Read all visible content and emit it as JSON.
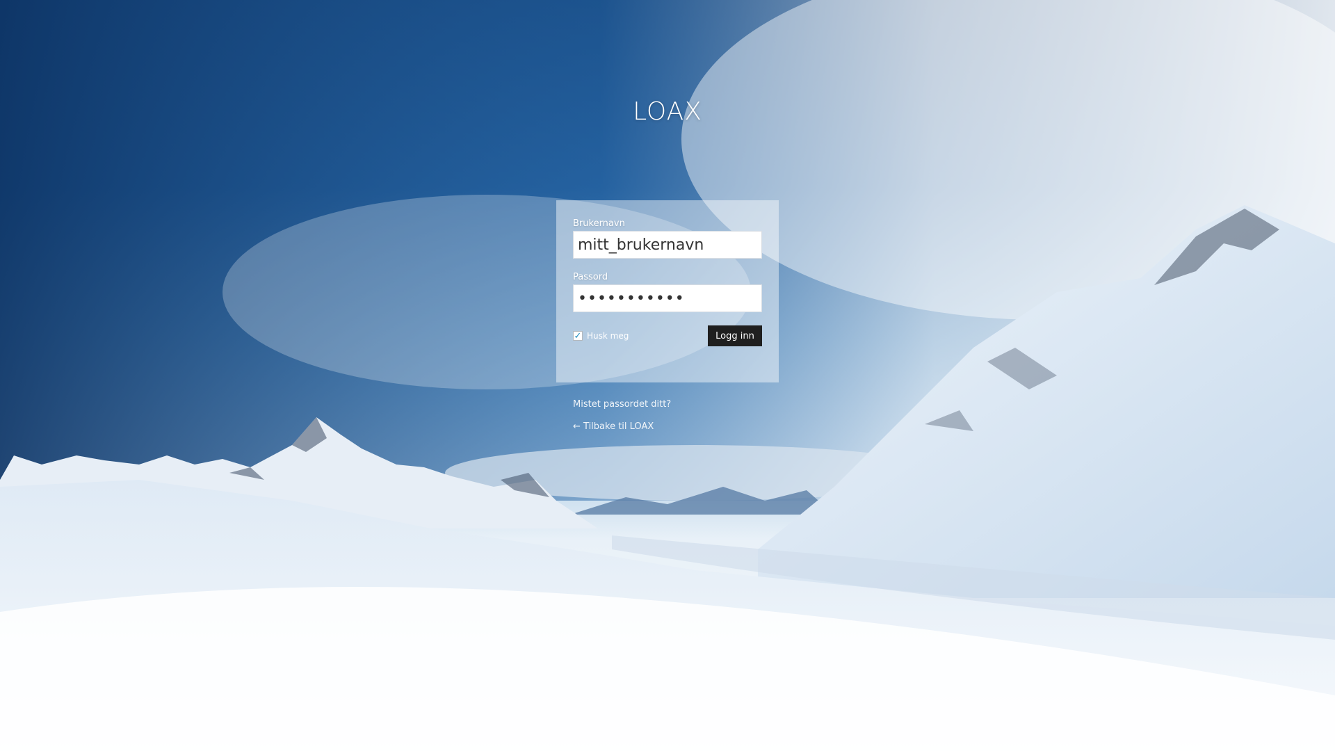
{
  "site": {
    "title": "LOAX"
  },
  "login_form": {
    "username_label": "Brukernavn",
    "username_value": "mitt_brukernavn",
    "password_label": "Passord",
    "password_value": "•••••••••••",
    "remember_label": "Husk meg",
    "remember_checked": true,
    "submit_label": "Logg inn"
  },
  "links": {
    "lost_password": "Mistet passordet ditt?",
    "back_to_site": "← Tilbake til LOAX"
  },
  "colors": {
    "button_bg": "#1f1f1f",
    "checkbox_accent": "#1e8cbe",
    "sky": "#1f5a98",
    "snow": "#f5f9fc"
  },
  "icons": {
    "checkbox": "checkmark-icon"
  }
}
